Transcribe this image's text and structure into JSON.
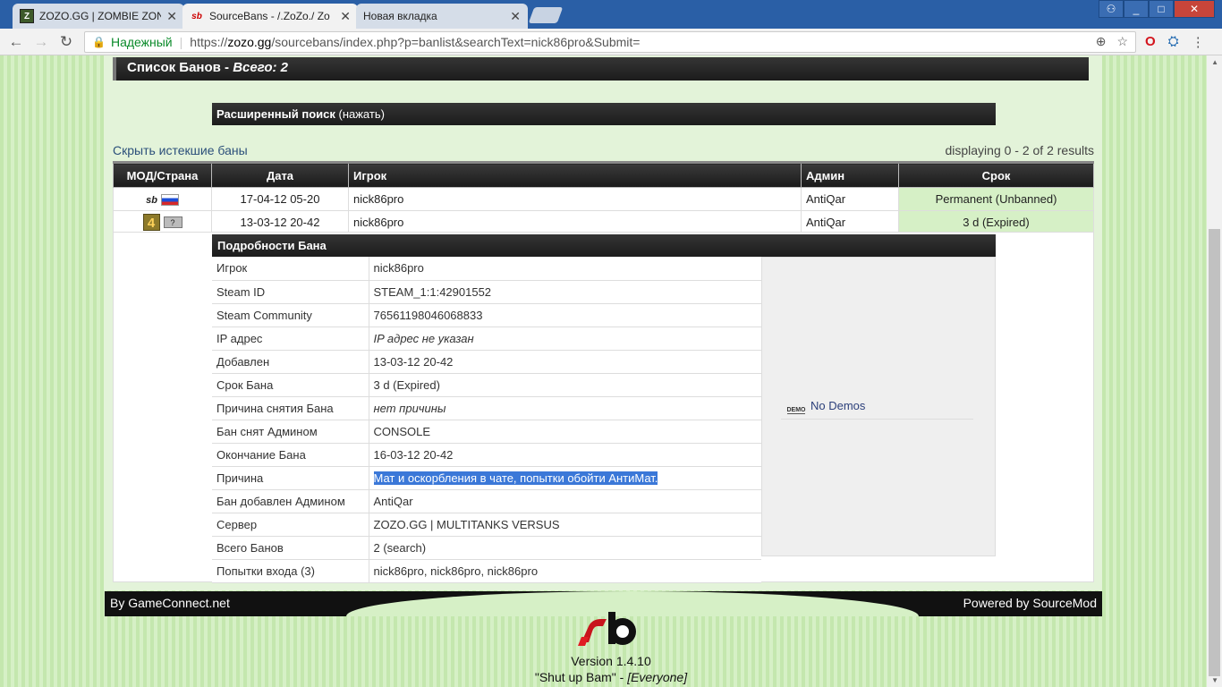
{
  "tabs": [
    {
      "icon": "Z",
      "title": "ZOZO.GG | ZOMBIE ZON",
      "active": false
    },
    {
      "icon": "sb",
      "title": "SourceBans - /.ZoZo./ Zo",
      "active": true
    },
    {
      "icon": "",
      "title": "Новая вкладка",
      "active": false
    }
  ],
  "window_buttons": [
    "_",
    "□",
    "✕"
  ],
  "address": {
    "secure_label": "Надежный",
    "scheme": "https://",
    "host": "zozo.gg",
    "path": "/sourcebans/index.php?p=banlist&searchText=nick86pro&Submit="
  },
  "page": {
    "list_title": "Список Банов - ",
    "list_total": "Всего: 2",
    "adv_search_bold": "Расширенный поиск",
    "adv_search_link": " (нажать)",
    "hide_expired": "Скрыть истекшие баны",
    "displaying": "displaying 0 - 2 of 2 results",
    "columns": [
      "МОД/Страна",
      "Дата",
      "Игрок",
      "Админ",
      "Срок"
    ],
    "rows": [
      {
        "date": "17-04-12 05-20",
        "player": "nick86pro",
        "admin": "AntiQar",
        "term": "Permanent (Unbanned)"
      },
      {
        "date": "13-03-12 20-42",
        "player": "nick86pro",
        "admin": "AntiQar",
        "term": "3 d (Expired)"
      }
    ],
    "details_title": "Подробности Бана",
    "details": [
      {
        "label": "Игрок",
        "value": "nick86pro"
      },
      {
        "label": "Steam ID",
        "value": "STEAM_1:1:42901552"
      },
      {
        "label": "Steam Community",
        "value": "76561198046068833"
      },
      {
        "label": "IP адрес",
        "value": "IP адрес не указан"
      },
      {
        "label": "Добавлен",
        "value": "13-03-12 20-42"
      },
      {
        "label": "Срок Бана",
        "value": "3 d (Expired)"
      },
      {
        "label": "Причина снятия Бана",
        "value": "нет причины"
      },
      {
        "label": "Бан снят Админом",
        "value": "CONSOLE"
      },
      {
        "label": "Окончание Бана",
        "value": "16-03-12 20-42"
      },
      {
        "label": "Причина",
        "value": "Мат и оскорбления в чате, попытки обойти АнтиМат."
      },
      {
        "label": "Бан добавлен Админом",
        "value": "AntiQar"
      },
      {
        "label": "Сервер",
        "value": "ZOZO.GG | MULTITANKS VERSUS"
      },
      {
        "label": "Всего Банов",
        "value": "2 (search)"
      },
      {
        "label": "Попытки входа (3)",
        "value": "nick86pro, nick86pro, nick86pro"
      }
    ],
    "demo_label": "No Demos",
    "demo_icon_text": "DEMO",
    "footer_left": "By GameConnect.net",
    "footer_right": "Powered by SourceMod",
    "version": "Version 1.4.10",
    "quote": "\"Shut up Bam\" - ",
    "quote_author": "[Everyone]"
  }
}
